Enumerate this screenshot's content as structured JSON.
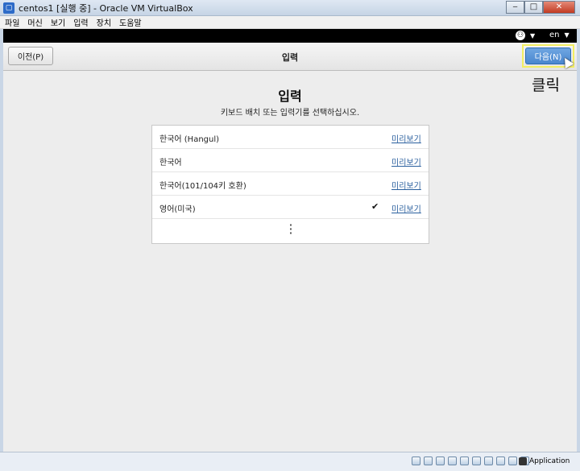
{
  "window": {
    "title": "centos1 [실행 중] - Oracle VM VirtualBox",
    "minimize_glyph": "‒",
    "maximize_glyph": "□",
    "close_glyph": "✕"
  },
  "menu": {
    "items": [
      "파일",
      "머신",
      "보기",
      "입력",
      "장치",
      "도움말"
    ]
  },
  "topbar": {
    "accessibility_icon": "accessibility-icon",
    "language": "en"
  },
  "header": {
    "prev_label": "이전(P)",
    "title": "입력",
    "next_label": "다음(N)"
  },
  "annotation": "클릭",
  "page": {
    "title": "입력",
    "subtitle": "키보드 배치 또는 입력기를 선택하십시오."
  },
  "layouts": [
    {
      "label": "한국어 (Hangul)",
      "preview": "미리보기",
      "checked": false
    },
    {
      "label": "한국어",
      "preview": "미리보기",
      "checked": false
    },
    {
      "label": "한국어(101/104키 호환)",
      "preview": "미리보기",
      "checked": false
    },
    {
      "label": "영어(미국)",
      "preview": "미리보기",
      "checked": true
    }
  ],
  "statusbar": {
    "host_key": "Application"
  },
  "colors": {
    "next_button": "#4a87cf",
    "highlight": "#f3ee62",
    "link": "#2a5f9e"
  }
}
